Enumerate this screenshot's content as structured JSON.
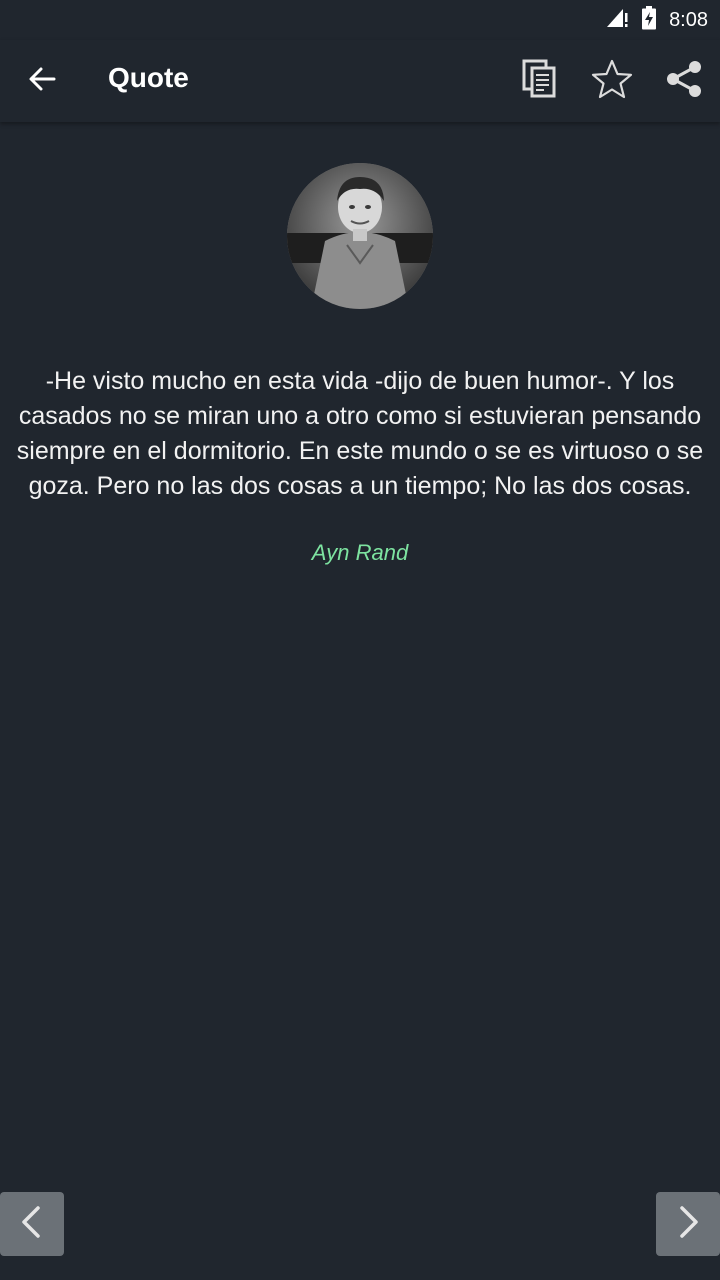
{
  "status_bar": {
    "time": "8:08",
    "icons": [
      "signal-icon",
      "battery-charging-icon"
    ]
  },
  "app_bar": {
    "title": "Quote",
    "actions": [
      "back-arrow-icon",
      "copy-icon",
      "star-icon",
      "share-icon"
    ]
  },
  "quote": {
    "text": "-He visto mucho en esta vida -dijo de buen humor-. Y los casados no se miran uno a otro como si estuvieran pensando siempre en el dormitorio. En este mundo o se es virtuoso o se goza. Pero no las dos cosas a un tiempo; No las dos cosas.",
    "author": "Ayn Rand"
  },
  "navigation": {
    "prev_icon": "chevron-left-icon",
    "next_icon": "chevron-right-icon"
  },
  "colors": {
    "background": "#20262e",
    "author_accent": "#7de3a0",
    "nav_button": "#6b7177"
  }
}
